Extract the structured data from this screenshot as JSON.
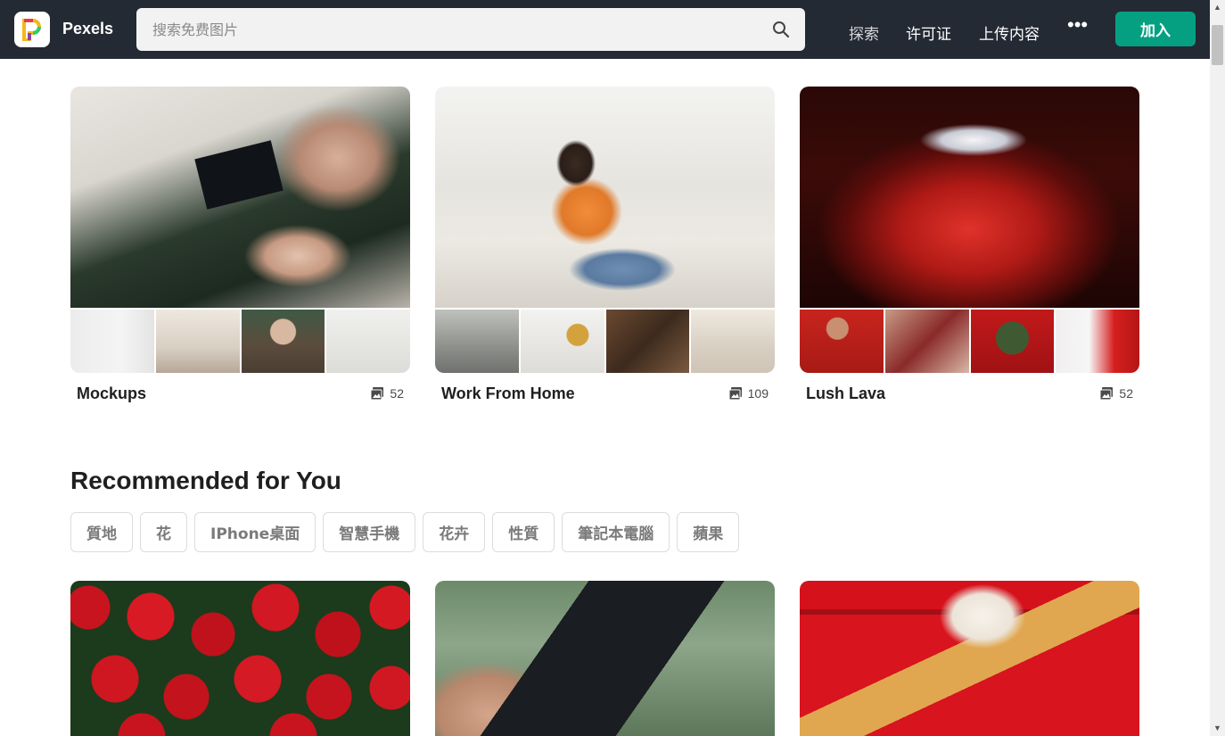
{
  "header": {
    "brand": "Pexels",
    "search_placeholder": "搜索免费图片",
    "nav": {
      "explore": "探索",
      "license": "许可证",
      "upload": "上传内容",
      "more": "•••"
    },
    "join_label": "加入",
    "accent_color": "#05a081",
    "bar_color": "#232a34",
    "icons": {
      "logo": "pexels-logo-icon",
      "search": "search-icon",
      "more": "more-dots-icon"
    }
  },
  "collections": [
    {
      "title": "Mockups",
      "count": "52",
      "icon": "photos-icon"
    },
    {
      "title": "Work From Home",
      "count": "109",
      "icon": "photos-icon"
    },
    {
      "title": "Lush Lava",
      "count": "52",
      "icon": "photos-icon"
    }
  ],
  "recommended": {
    "title": "Recommended for You",
    "tags": [
      "質地",
      "花",
      "IPhone桌面",
      "智慧手機",
      "花卉",
      "性質",
      "筆記本電腦",
      "蘋果"
    ]
  }
}
